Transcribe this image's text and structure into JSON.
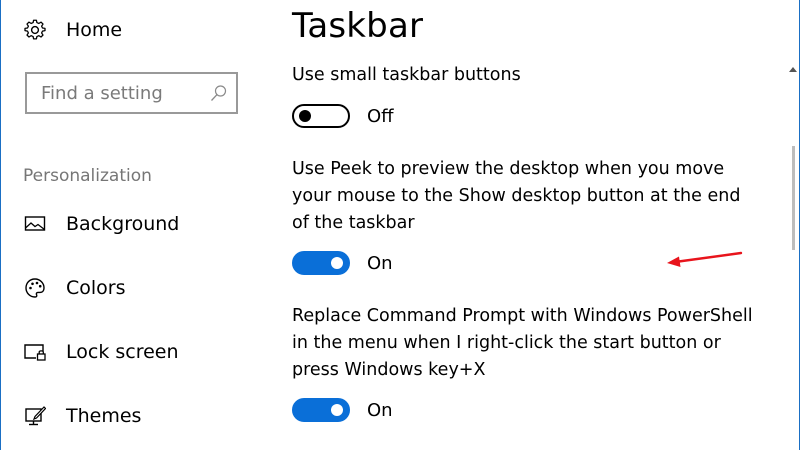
{
  "sidebar": {
    "home_label": "Home",
    "search": {
      "placeholder": "Find a setting",
      "value": ""
    },
    "section_header": "Personalization",
    "items": [
      {
        "label": "Background",
        "icon": "picture-icon"
      },
      {
        "label": "Colors",
        "icon": "palette-icon"
      },
      {
        "label": "Lock screen",
        "icon": "lock-screen-icon"
      },
      {
        "label": "Themes",
        "icon": "themes-icon"
      }
    ]
  },
  "main": {
    "title": "Taskbar",
    "settings": [
      {
        "description": "Use small taskbar buttons",
        "state": "Off",
        "enabled": false
      },
      {
        "description": "Use Peek to preview the desktop when you move your mouse to the Show desktop button at the end of the taskbar",
        "state": "On",
        "enabled": true
      },
      {
        "description": "Replace Command Prompt with Windows PowerShell in the menu when I right-click the start button or press Windows key+X",
        "state": "On",
        "enabled": true
      }
    ]
  },
  "colors": {
    "accent": "#0a6fd8",
    "window_border": "#1a6fc4",
    "annotation": "#e8141c",
    "secondary_text": "#767676"
  }
}
